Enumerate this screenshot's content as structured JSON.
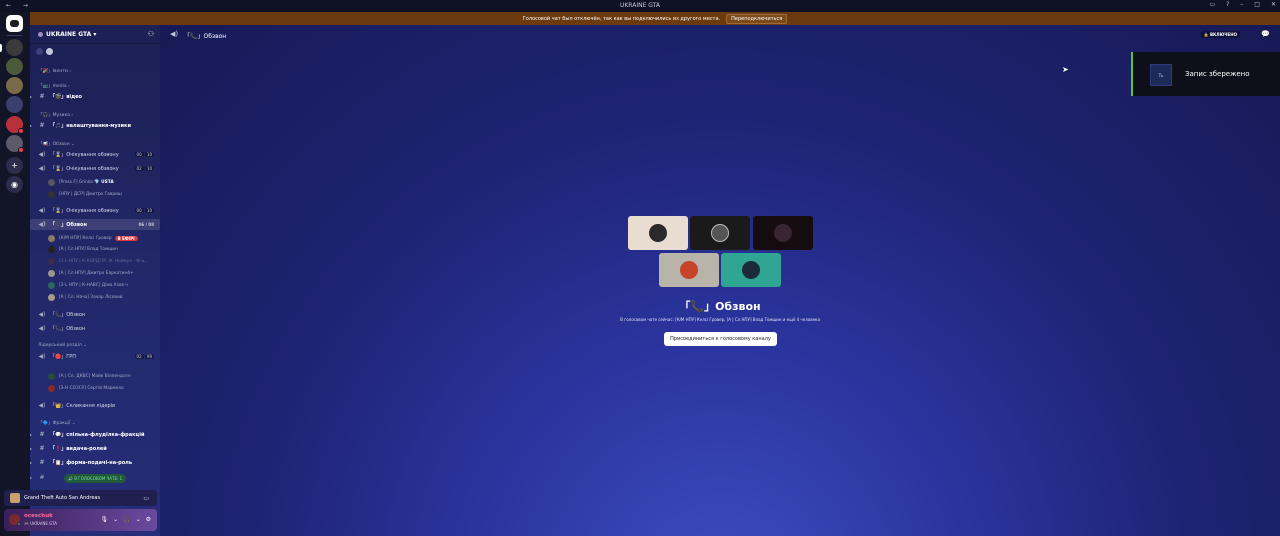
{
  "titlebar": {
    "title": "UKRAINE GTA",
    "nav": "← →",
    "controls": [
      "▭",
      "?",
      "–",
      "□",
      "✕"
    ]
  },
  "banner": {
    "text": "Голосовой чат был отключён, так как вы подключились из другого места.",
    "button": "Переподключиться"
  },
  "server": {
    "name": "UKRAINE GTA ▾",
    "invite_icon": "person-add-icon"
  },
  "sidebar": {
    "cat_ivents": "「🎉」Івенти ›",
    "cat_media": "「📺」media ›",
    "chan_video": "「🎬」відео",
    "cat_music": "「🎧」Музика ›",
    "chan_music_settings": "「🎵」налаштування-музики",
    "cat_obzvon": "「📢」Обзвон ⌄",
    "chan_wait1": "「⌛」Очікування обзвону",
    "chan_wait1_count": "00",
    "chan_wait1_max": "10",
    "chan_wait2": "「⌛」Очікування обзвону",
    "chan_wait2_count": "02",
    "chan_wait2_max": "10",
    "user_grinka": "[Press F] Grinka",
    "user_grinka_tag": "💎 USTA",
    "user_havrysh": "[НПУ | ДСР] Дмитро Гавриш",
    "chan_wait3": "「⌛」Очікування обзвону",
    "chan_wait3_count": "00",
    "chan_wait3_max": "10",
    "chan_obzvon": "「📞」Обзвон",
    "chan_obzvon_count": "06 / 08",
    "user_hrover": "[К/М НПУ] Келсі Гровер",
    "live": "В ЕФІРІ",
    "user_tomchyn": "[А | Сл.НПУ] Влад Томщин",
    "user_kord": "[З-L НПУ | К-КОРД] М. Ф. Ноймун · Ф-ц...",
    "user_barkatin": "[А | Сл.НПУ] Дмитро Баркатин4+",
    "user_azov": "[З-L НПУ | К-НАВС] Діма Азов ч",
    "user_lisovyi": "[А | Сл. Нача] Захар Лісовий",
    "chan_obzvon2": "「📞」Обзвон",
    "chan_obzvon3": "「📞」Обзвон",
    "cat_leaders": "Лідерський розділ ⌄",
    "chan_rp": "「🔴」ГРП",
    "chan_rp_count": "02",
    "chan_rp_max": "99",
    "user_mike": "[А | Сл. ДКВС] Майк Віллендсен",
    "user_marmelo": "[З-Н СОЗСУ] Сергій Мармело",
    "chan_leaders_call": "「👑」Скликання лідерів",
    "cat_factions": "「🔷」Фракції ⌄",
    "chan_flood": "「💬」спільна-флуділка-фракцій",
    "chan_roles": "「❗」видача-ролей",
    "chan_form": "「📋」форма-подачі-на-роль",
    "voice_pill": "🔊 В ГОЛОСОВОМ ЧАТЕ: 1"
  },
  "activity": {
    "game": "Grand Theft Auto San Andreas"
  },
  "user": {
    "name": "oceschuk",
    "status": "🎮 UKRAINE GTA"
  },
  "header": {
    "channel": "「📞」Обзвон",
    "status": "🔒 ВКЛЮЧЕНО"
  },
  "voice": {
    "title": "「📞」Обзвон",
    "subtitle": "В голосовом чате сейчас: [К/М НПУ] Келсі Гровер, [А | Сл.НПУ] Влад Томщин и ещё 4 человека",
    "join_button": "Присоединиться к голосовому каналу"
  },
  "toast": {
    "icon_text": "Ть",
    "text": "Запис збережено"
  },
  "colors": {
    "accent_toast": "#5fbf3a",
    "banner": "#6b3a0e",
    "live": "#da373c"
  }
}
